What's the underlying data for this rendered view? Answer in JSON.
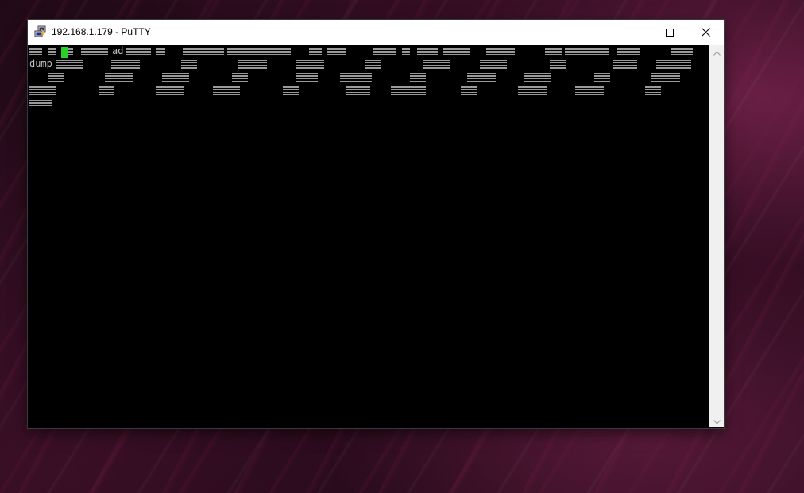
{
  "window": {
    "title": "192.168.1.179 - PuTTY",
    "app_icon": "putty-icon",
    "controls": {
      "minimize_icon": "minimize-icon",
      "maximize_icon": "maximize-icon",
      "close_icon": "close-icon"
    }
  },
  "terminal": {
    "line1_text": "ad",
    "line2_text": "dump",
    "foreground_color": "#bfbfbf",
    "background_color": "#000000",
    "cursor_color": "#27d327"
  },
  "scrollbar": {
    "up_icon": "chevron-up-icon",
    "down_icon": "chevron-down-icon"
  }
}
